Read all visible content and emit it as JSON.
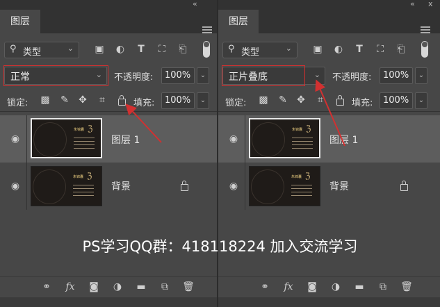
{
  "panels": [
    {
      "tab": "图层",
      "filter": "类型",
      "blend_mode": "正常",
      "opacity_label": "不透明度:",
      "opacity_value": "100%",
      "lock_label": "锁定:",
      "fill_label": "填充:",
      "fill_value": "100%",
      "layers": [
        {
          "name": "图层 1",
          "selected": true,
          "locked": false,
          "card_title": "朱锦囊"
        },
        {
          "name": "背景",
          "selected": false,
          "locked": true,
          "card_title": "朱锦囊"
        }
      ]
    },
    {
      "tab": "图层",
      "filter": "类型",
      "blend_mode": "正片叠底",
      "opacity_label": "不透明度:",
      "opacity_value": "100%",
      "lock_label": "锁定:",
      "fill_label": "填充:",
      "fill_value": "100%",
      "layers": [
        {
          "name": "图层 1",
          "selected": true,
          "locked": false,
          "card_title": "朱锦囊"
        },
        {
          "name": "背景",
          "selected": false,
          "locked": true,
          "card_title": "朱锦囊"
        }
      ]
    }
  ],
  "icons": {
    "collapse": "«",
    "close": "x",
    "menu": "hamburger-icon",
    "filter_icons": [
      "image-filter-icon",
      "adjustment-filter-icon",
      "type-filter-icon",
      "shape-filter-icon",
      "smart-object-filter-icon"
    ],
    "lock_icons": [
      "lock-transparent-icon",
      "lock-image-icon",
      "lock-position-icon",
      "lock-artboard-icon",
      "lock-all-icon"
    ],
    "bottom_icons": [
      "link-icon",
      "fx-icon",
      "mask-icon",
      "adjustment-icon",
      "folder-icon",
      "new-layer-icon",
      "trash-icon"
    ]
  },
  "colors": {
    "panel_bg": "#474747",
    "selected_row": "#5d5d5d",
    "highlight_red": "#d23030"
  },
  "overlay_text": "PS学习QQ群：418118224  加入交流学习"
}
